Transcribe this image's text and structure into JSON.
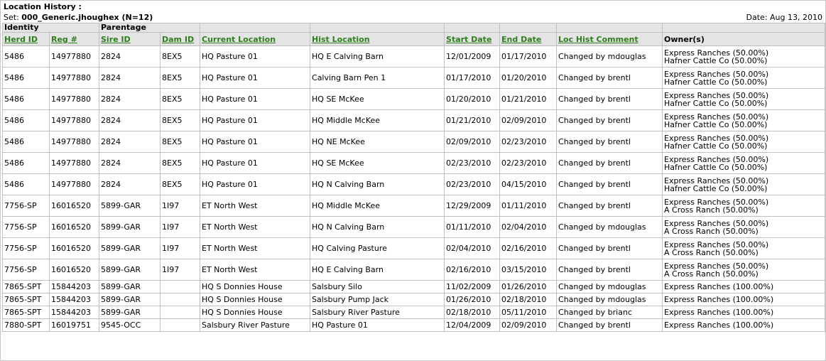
{
  "report": {
    "title": "Location History :",
    "set_label": "Set: ",
    "set_value": "000_Generic.jhoughex (N=12)",
    "date": "Date: Aug 13, 2010"
  },
  "groups": {
    "identity": "Identity",
    "parentage": "Parentage"
  },
  "columns": {
    "herd_id": "Herd ID",
    "reg": "Reg #",
    "sire_id": "Sire ID",
    "dam_id": "Dam ID",
    "current_location": "Current Location",
    "hist_location": "Hist Location",
    "start_date": "Start Date",
    "end_date": "End Date",
    "comment": "Loc Hist Comment",
    "owners": "Owner(s)"
  },
  "rows": [
    {
      "herd": "5486",
      "reg": "14977880",
      "sire": "2824",
      "dam": "8EX5",
      "cur": "HQ Pasture 01",
      "hist": "HQ E Calving Barn",
      "start": "12/01/2009",
      "end": "01/17/2010",
      "comment": "Changed by mdouglas",
      "owners": [
        "Express Ranches (50.00%)",
        "Hafner Cattle Co (50.00%)"
      ]
    },
    {
      "herd": "5486",
      "reg": "14977880",
      "sire": "2824",
      "dam": "8EX5",
      "cur": "HQ Pasture 01",
      "hist": "Calving Barn Pen 1",
      "start": "01/17/2010",
      "end": "01/20/2010",
      "comment": "Changed by brentl",
      "owners": [
        "Express Ranches (50.00%)",
        "Hafner Cattle Co (50.00%)"
      ]
    },
    {
      "herd": "5486",
      "reg": "14977880",
      "sire": "2824",
      "dam": "8EX5",
      "cur": "HQ Pasture 01",
      "hist": "HQ SE McKee",
      "start": "01/20/2010",
      "end": "01/21/2010",
      "comment": "Changed by brentl",
      "owners": [
        "Express Ranches (50.00%)",
        "Hafner Cattle Co (50.00%)"
      ]
    },
    {
      "herd": "5486",
      "reg": "14977880",
      "sire": "2824",
      "dam": "8EX5",
      "cur": "HQ Pasture 01",
      "hist": "HQ Middle McKee",
      "start": "01/21/2010",
      "end": "02/09/2010",
      "comment": "Changed by brentl",
      "owners": [
        "Express Ranches (50.00%)",
        "Hafner Cattle Co (50.00%)"
      ]
    },
    {
      "herd": "5486",
      "reg": "14977880",
      "sire": "2824",
      "dam": "8EX5",
      "cur": "HQ Pasture 01",
      "hist": "HQ NE McKee",
      "start": "02/09/2010",
      "end": "02/23/2010",
      "comment": "Changed by brentl",
      "owners": [
        "Express Ranches (50.00%)",
        "Hafner Cattle Co (50.00%)"
      ]
    },
    {
      "herd": "5486",
      "reg": "14977880",
      "sire": "2824",
      "dam": "8EX5",
      "cur": "HQ Pasture 01",
      "hist": "HQ SE McKee",
      "start": "02/23/2010",
      "end": "02/23/2010",
      "comment": "Changed by brentl",
      "owners": [
        "Express Ranches (50.00%)",
        "Hafner Cattle Co (50.00%)"
      ]
    },
    {
      "herd": "5486",
      "reg": "14977880",
      "sire": "2824",
      "dam": "8EX5",
      "cur": "HQ Pasture 01",
      "hist": "HQ N Calving Barn",
      "start": "02/23/2010",
      "end": "04/15/2010",
      "comment": "Changed by brentl",
      "owners": [
        "Express Ranches (50.00%)",
        "Hafner Cattle Co (50.00%)"
      ]
    },
    {
      "herd": "7756-SP",
      "reg": "16016520",
      "sire": "5899-GAR",
      "dam": "1I97",
      "cur": "ET North West",
      "hist": "HQ Middle McKee",
      "start": "12/29/2009",
      "end": "01/11/2010",
      "comment": "Changed by brentl",
      "owners": [
        "Express Ranches (50.00%)",
        "A Cross Ranch (50.00%)"
      ]
    },
    {
      "herd": "7756-SP",
      "reg": "16016520",
      "sire": "5899-GAR",
      "dam": "1I97",
      "cur": "ET North West",
      "hist": "HQ N Calving Barn",
      "start": "01/11/2010",
      "end": "02/04/2010",
      "comment": "Changed by mdouglas",
      "owners": [
        "Express Ranches (50.00%)",
        "A Cross Ranch (50.00%)"
      ]
    },
    {
      "herd": "7756-SP",
      "reg": "16016520",
      "sire": "5899-GAR",
      "dam": "1I97",
      "cur": "ET North West",
      "hist": "HQ Calving Pasture",
      "start": "02/04/2010",
      "end": "02/16/2010",
      "comment": "Changed by brentl",
      "owners": [
        "Express Ranches (50.00%)",
        "A Cross Ranch (50.00%)"
      ]
    },
    {
      "herd": "7756-SP",
      "reg": "16016520",
      "sire": "5899-GAR",
      "dam": "1I97",
      "cur": "ET North West",
      "hist": "HQ E Calving Barn",
      "start": "02/16/2010",
      "end": "03/15/2010",
      "comment": "Changed by brentl",
      "owners": [
        "Express Ranches (50.00%)",
        "A Cross Ranch (50.00%)"
      ]
    },
    {
      "herd": "7865-SPT",
      "reg": "15844203",
      "sire": "5899-GAR",
      "dam": "",
      "cur": "HQ S Donnies House",
      "hist": "Salsbury Silo",
      "start": "11/02/2009",
      "end": "01/26/2010",
      "comment": "Changed by mdouglas",
      "owners": [
        "Express Ranches (100.00%)"
      ]
    },
    {
      "herd": "7865-SPT",
      "reg": "15844203",
      "sire": "5899-GAR",
      "dam": "",
      "cur": "HQ S Donnies House",
      "hist": "Salsbury Pump Jack",
      "start": "01/26/2010",
      "end": "02/18/2010",
      "comment": "Changed by mdouglas",
      "owners": [
        "Express Ranches (100.00%)"
      ]
    },
    {
      "herd": "7865-SPT",
      "reg": "15844203",
      "sire": "5899-GAR",
      "dam": "",
      "cur": "HQ S Donnies House",
      "hist": "Salsbury River Pasture",
      "start": "02/18/2010",
      "end": "05/11/2010",
      "comment": "Changed by brianc",
      "owners": [
        "Express Ranches (100.00%)"
      ]
    },
    {
      "herd": "7880-SPT",
      "reg": "16019751",
      "sire": "9545-OCC",
      "dam": "",
      "cur": "Salsbury River Pasture",
      "hist": "HQ Pasture 01",
      "start": "12/04/2009",
      "end": "02/09/2010",
      "comment": "Changed by brentl",
      "owners": [
        "Express Ranches (100.00%)"
      ]
    }
  ]
}
